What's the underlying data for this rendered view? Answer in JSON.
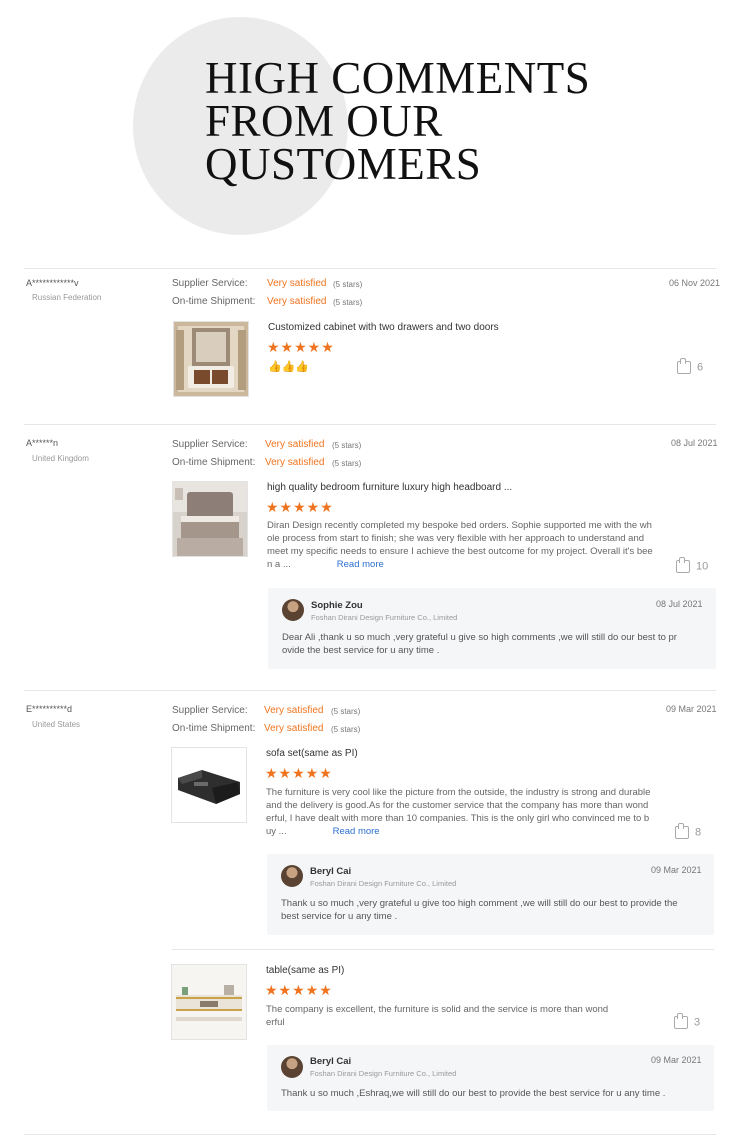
{
  "header": {
    "title_lines": [
      "HIGH COMMENTS",
      "FROM OUR",
      "QUSTOMERS"
    ]
  },
  "labels": {
    "supplier_service": "Supplier Service:",
    "ontime_shipment": "On-time Shipment:",
    "read_more": "Read more"
  },
  "reviews": [
    {
      "reviewer": "A************v",
      "country": "Russian Federation",
      "supplier_service": "Very satisfied",
      "supplier_stars": "(5 stars)",
      "ontime": "Very satisfied",
      "ontime_stars": "(5 stars)",
      "date": "06 Nov 2021",
      "product": "Customized cabinet with two drawers and two doors",
      "rating": 5,
      "emoji": "👍👍👍",
      "likes": "6"
    },
    {
      "reviewer": "A******n",
      "country": "United Kingdom",
      "supplier_service": "Very satisfied",
      "supplier_stars": "(5 stars)",
      "ontime": "Very satisfied",
      "ontime_stars": "(5 stars)",
      "date": "08 Jul 2021",
      "product": "high quality bedroom furniture luxury high headboard ...",
      "rating": 5,
      "body_lines": [
        "Diran Design recently completed my bespoke bed orders. Sophie supported me with the wh",
        "ole process from start to finish; she was very flexible with her approach to understand and",
        "meet my specific needs to ensure I achieve the best outcome for my project. Overall it's bee",
        "n a ..."
      ],
      "likes": "10",
      "reply": {
        "name": "Sophie Zou",
        "company": "Foshan Dirani Design Furniture Co., Limited",
        "date": "08 Jul 2021",
        "text_lines": [
          "Dear Ali ,thank u so much ,very grateful u give so high comments ,we will still do our best to pr",
          "ovide the best service for u any time ."
        ]
      }
    },
    {
      "reviewer": "E**********d",
      "country": "United States",
      "supplier_service": "Very satisfied",
      "supplier_stars": "(5 stars)",
      "ontime": "Very satisfied",
      "ontime_stars": "(5 stars)",
      "date": "09 Mar 2021",
      "items": [
        {
          "product": "sofa set(same as PI)",
          "rating": 5,
          "body_lines": [
            "The furniture is very cool like the picture from the outside, the industry is strong and durable",
            "and the delivery is good.As for the customer service that the company has more than wond",
            "erful, I have dealt with more than 10 companies. This is the only girl who convinced me to b",
            "uy ..."
          ],
          "likes": "8",
          "reply": {
            "name": "Beryl Cai",
            "company": "Foshan Dirani Design Furniture Co., Limited",
            "date": "09 Mar 2021",
            "text_lines": [
              "Thank u so much ,very grateful u give too high comment ,we will still do our best to provide the",
              "best service for u any time ."
            ]
          }
        },
        {
          "product": "table(same as PI)",
          "rating": 5,
          "body_lines": [
            "The company is excellent, the furniture is solid and the service is more than wond",
            "erful"
          ],
          "likes": "3",
          "reply": {
            "name": "Beryl Cai",
            "company": "Foshan Dirani Design Furniture Co., Limited",
            "date": "09 Mar 2021",
            "text_lines": [
              "Thank u so much ,Eshraq,we will still do our best to provide the best service for u any time ."
            ]
          }
        }
      ]
    }
  ],
  "colors": {
    "accent": "#f0741f",
    "link": "#2c6fd1",
    "reply_bg": "#f5f6f8"
  }
}
